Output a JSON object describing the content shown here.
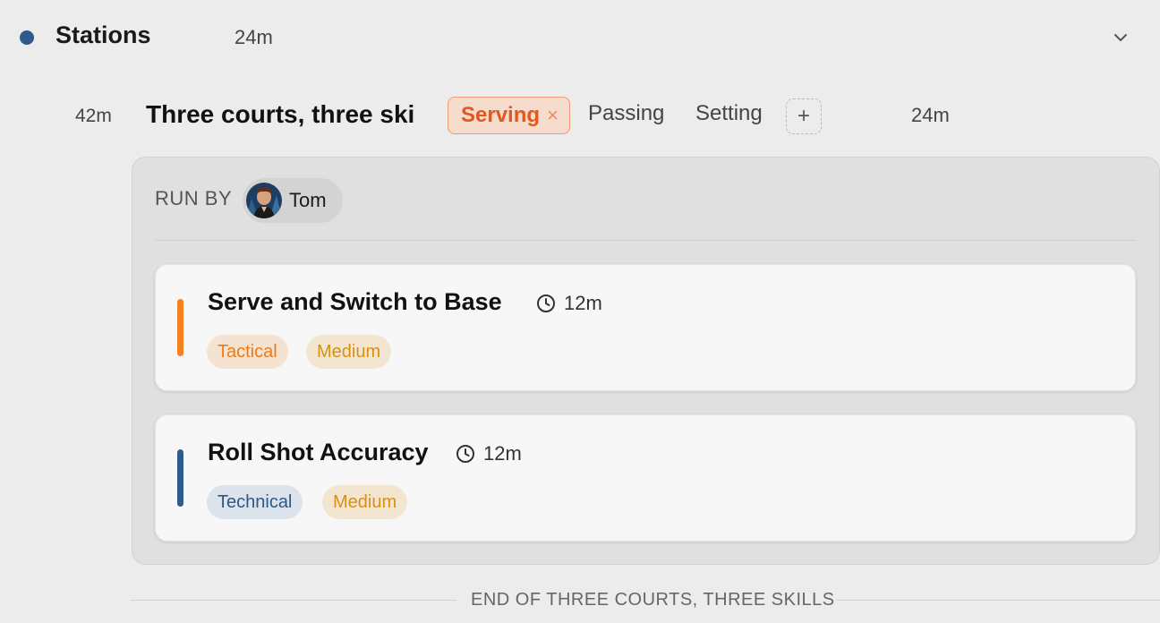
{
  "section": {
    "title": "Stations",
    "duration": "24m"
  },
  "block": {
    "start": "42m",
    "title": "Three courts, three ski",
    "skills": {
      "active": "Serving",
      "passing": "Passing",
      "setting": "Setting",
      "add": "+"
    },
    "duration": "24m",
    "remove_symbol": "×"
  },
  "run_by": {
    "label": "RUN BY",
    "person": "Tom"
  },
  "drills": [
    {
      "title": "Serve and Switch to Base",
      "time": "12m",
      "category": "Tactical",
      "intensity": "Medium",
      "accent_color": "#f5821f"
    },
    {
      "title": "Roll Shot Accuracy",
      "time": "12m",
      "category": "Technical",
      "intensity": "Medium",
      "accent_color": "#2f5a8c"
    }
  ],
  "footer": {
    "end_label": "END OF THREE COURTS, THREE SKILLS"
  },
  "colors": {
    "section_dot": "#2f5a8c",
    "active_skill": "#e4571e",
    "tactical": "#ee7a15",
    "medium": "#d88f18",
    "technical": "#2d5886"
  }
}
